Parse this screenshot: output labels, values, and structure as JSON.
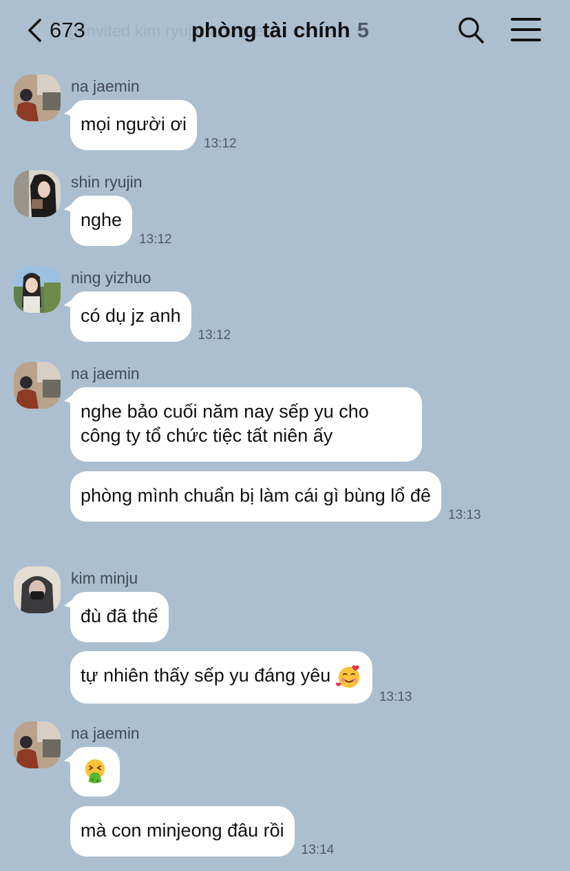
{
  "header": {
    "back_count": "673",
    "title": "phòng tài chính",
    "member_count": "5",
    "faded_system_text": "g invited kim                   ryujin and   jae"
  },
  "messages": [
    {
      "sender": "na jaemin",
      "avatar": "avatar-na-jaemin",
      "bubbles": [
        "mọi người ơi"
      ],
      "time": "13:12"
    },
    {
      "sender": "shin ryujin",
      "avatar": "avatar-shin-ryujin",
      "bubbles": [
        "nghe"
      ],
      "time": "13:12"
    },
    {
      "sender": "ning yizhuo",
      "avatar": "avatar-ning-yizhuo",
      "bubbles": [
        "có dụ jz anh"
      ],
      "time": "13:12"
    },
    {
      "sender": "na jaemin",
      "avatar": "avatar-na-jaemin",
      "bubbles": [
        "nghe bảo cuối năm nay sếp yu cho công ty tổ chức tiệc tất niên ấy",
        "phòng mình chuẩn bị làm cái gì bùng lổ đê"
      ],
      "time": "13:13"
    },
    {
      "sender": "kim minju",
      "avatar": "avatar-kim-minju",
      "bubbles": [
        "đù đã thế",
        "tự nhiên thấy sếp yu đáng yêu"
      ],
      "emoji": "smiling-face-with-hearts",
      "time": "13:13"
    },
    {
      "sender": "na jaemin",
      "avatar": "avatar-na-jaemin",
      "bubbles": [
        "",
        "mà con minjeong đâu rồi"
      ],
      "emoji": "vomiting-face",
      "time": "13:14"
    }
  ],
  "colors": {
    "background": "#acbfd1",
    "bubble": "#ffffff",
    "timestamp": "#4e5a66"
  }
}
